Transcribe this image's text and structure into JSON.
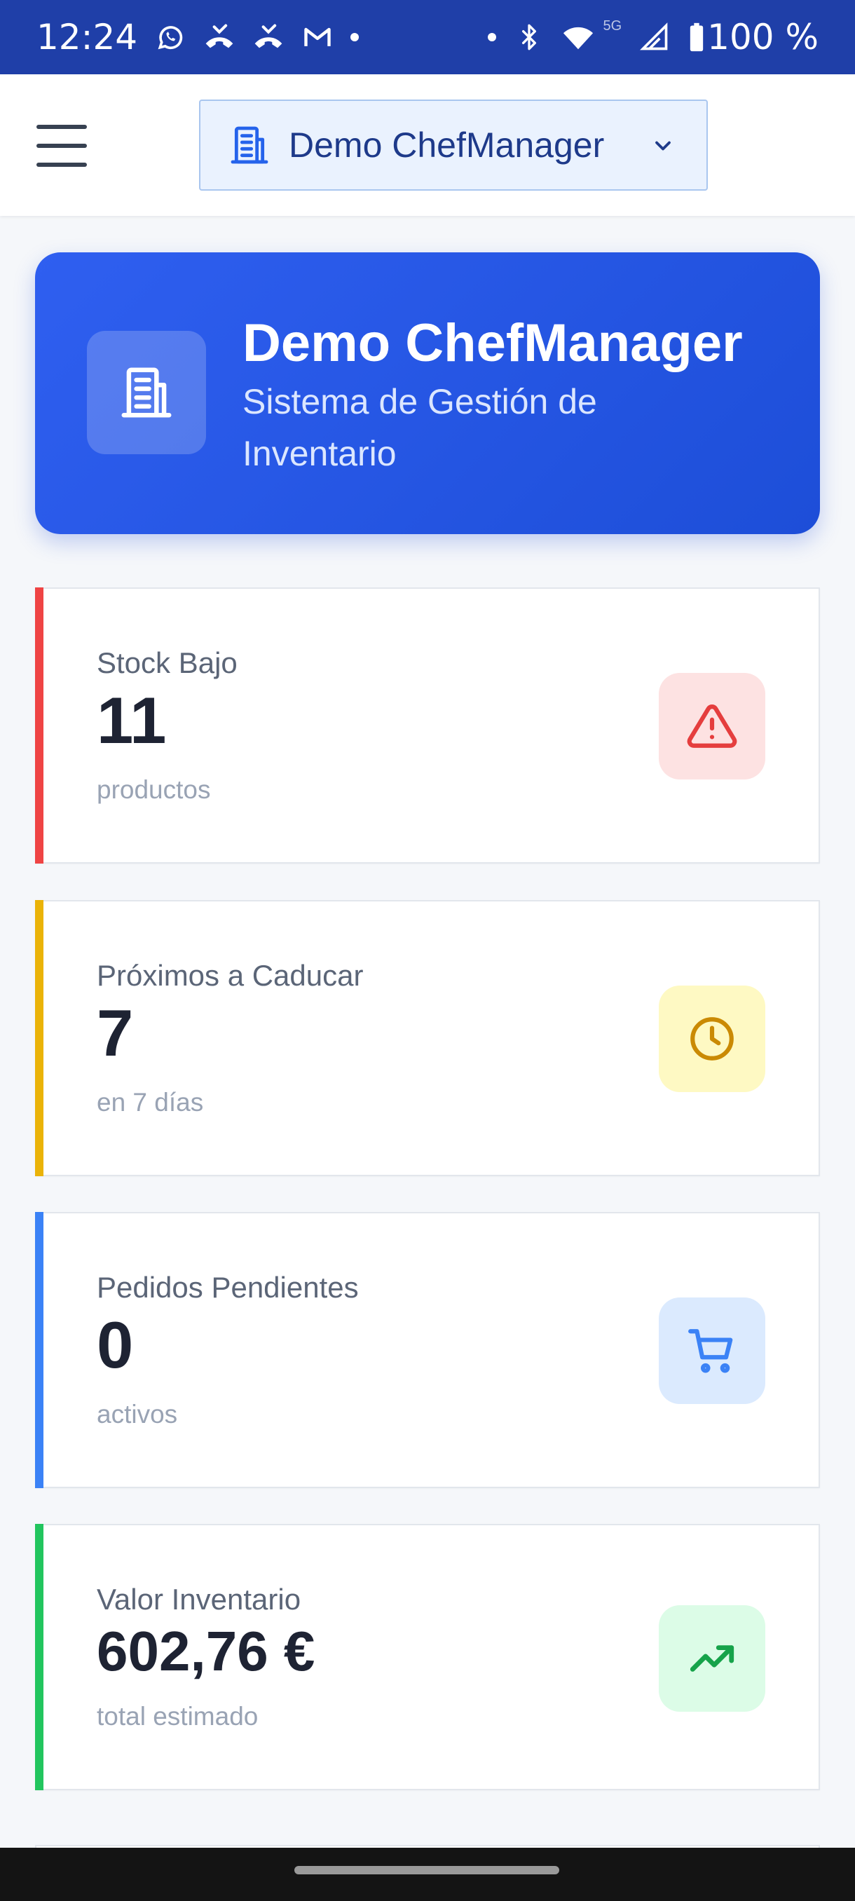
{
  "status_bar": {
    "time": "12:24",
    "network": "5G",
    "battery": "100 %",
    "icons": [
      "whatsapp-icon",
      "missed-call-icon",
      "missed-call-icon",
      "gmail-icon",
      "bluetooth-icon",
      "wifi-icon",
      "signal-icon",
      "battery-icon"
    ]
  },
  "appbar": {
    "org_name": "Demo ChefManager"
  },
  "hero": {
    "title": "Demo ChefManager",
    "subtitle": "Sistema de Gestión de Inventario"
  },
  "stats": [
    {
      "label": "Stock Bajo",
      "value": "11",
      "caption": "productos",
      "accent": "#ef4444",
      "icon": "alert-triangle-icon",
      "icon_color": "#e53e3e",
      "icon_bg": "#fde2e2"
    },
    {
      "label": "Próximos a Caducar",
      "value": "7",
      "caption": "en 7 días",
      "accent": "#eab308",
      "icon": "clock-icon",
      "icon_color": "#ca8a04",
      "icon_bg": "#fef9c3"
    },
    {
      "label": "Pedidos Pendientes",
      "value": "0",
      "caption": "activos",
      "accent": "#3b82f6",
      "icon": "cart-icon",
      "icon_color": "#3b82f6",
      "icon_bg": "#dbeafe"
    },
    {
      "label": "Valor Inventario",
      "value": "602,76 €",
      "caption": "total estimado",
      "accent": "#22c55e",
      "icon": "trending-up-icon",
      "icon_color": "#16a34a",
      "icon_bg": "#dcfce7"
    }
  ]
}
